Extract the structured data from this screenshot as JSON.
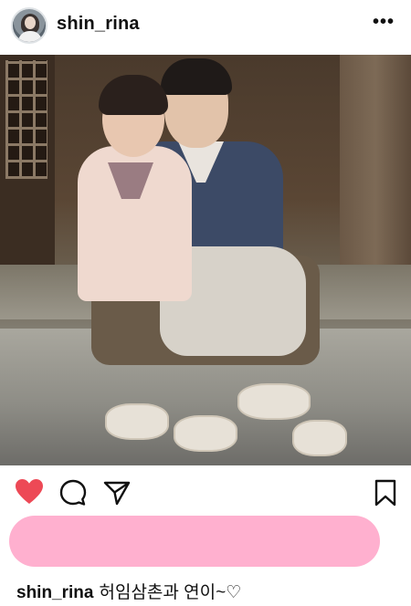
{
  "post": {
    "username": "shin_rina",
    "more_label": "•••",
    "caption_user": "shin_rina",
    "caption_text": "허임삼촌과 연이~♡"
  },
  "icons": {
    "like": "heart-icon",
    "comment": "comment-icon",
    "share": "share-icon",
    "save": "bookmark-icon",
    "more": "more-options-icon"
  },
  "colors": {
    "like_active": "#ED4956",
    "text": "#111111",
    "likes_redaction": "#FFB0CF"
  },
  "state": {
    "liked": true
  }
}
